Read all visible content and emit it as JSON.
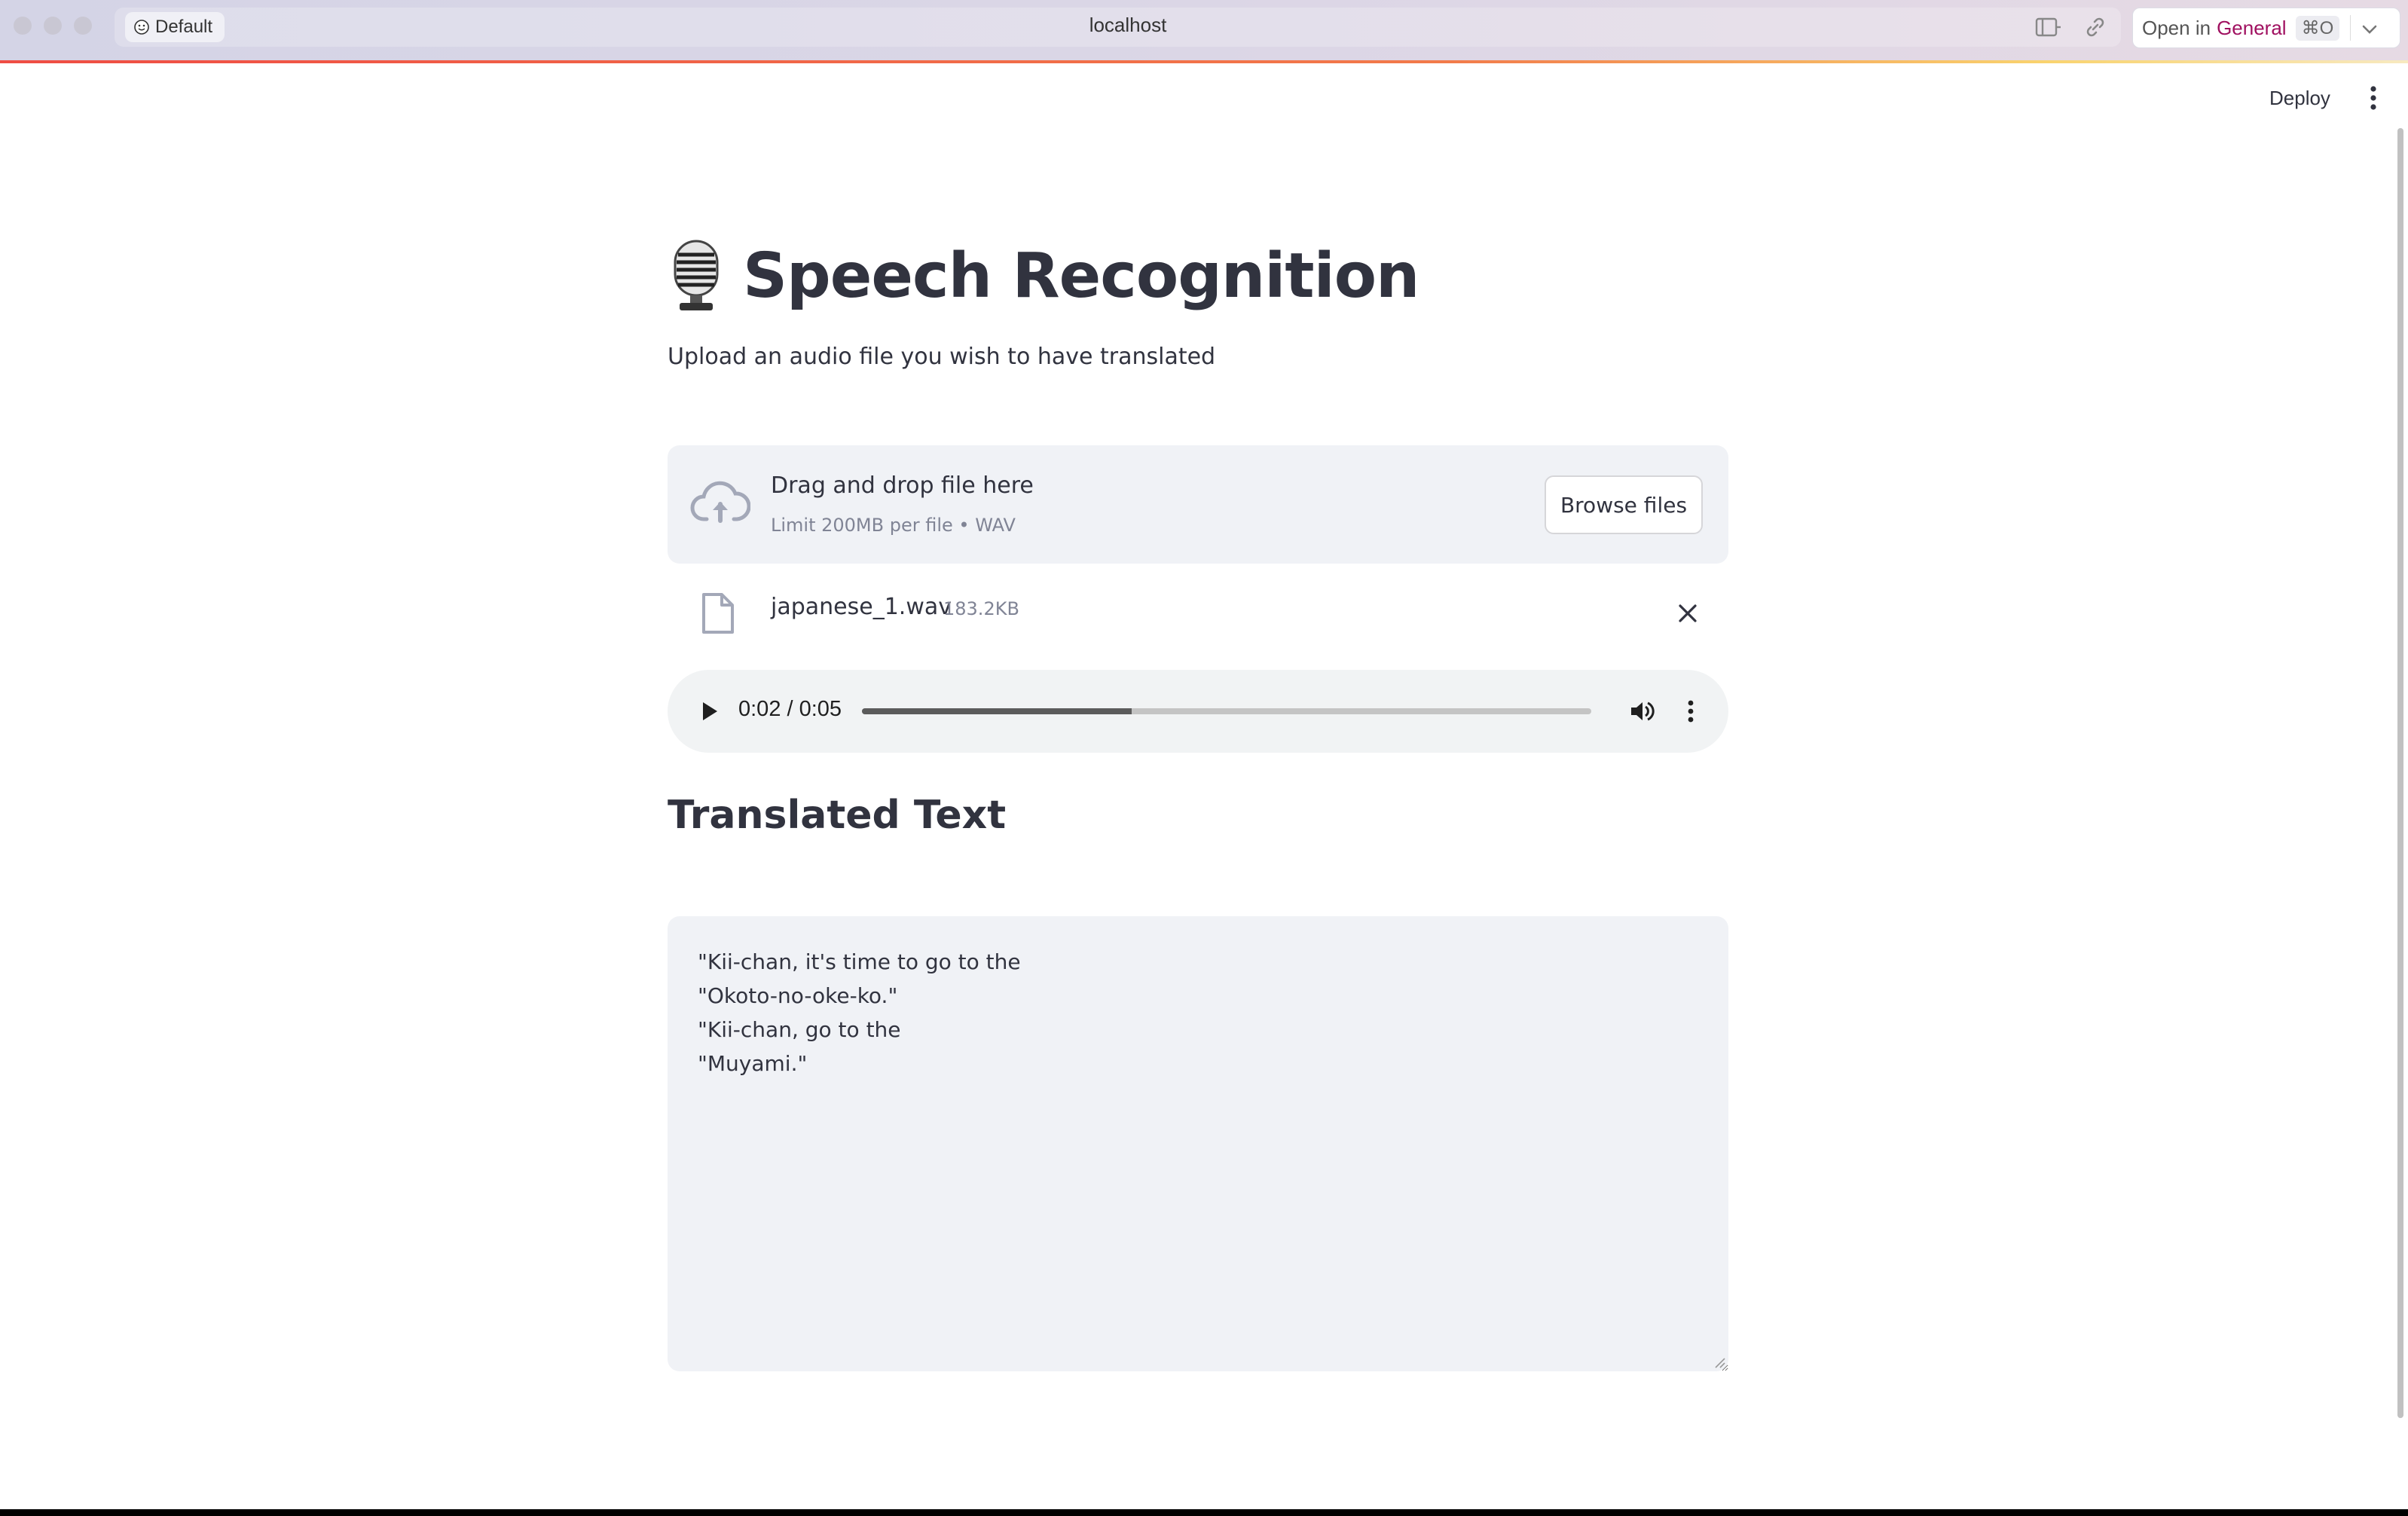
{
  "browser": {
    "profile_label": "Default",
    "url": "localhost",
    "open_in_label": "Open in",
    "open_in_target": "General",
    "open_in_shortcut": "⌘O"
  },
  "app_toolbar": {
    "deploy_label": "Deploy"
  },
  "page": {
    "title_icon": "🎙️",
    "title": "Speech Recognition",
    "subtitle": "Upload an audio file you wish to have translated"
  },
  "uploader": {
    "drag_text": "Drag and drop file here",
    "limit_text": "Limit 200MB per file • WAV",
    "browse_label": "Browse files",
    "file": {
      "name": "japanese_1.wav",
      "size": "183.2KB"
    }
  },
  "audio_player": {
    "time_display": "0:02 / 0:05",
    "progress_fraction": 0.37
  },
  "translation": {
    "heading": "Translated Text",
    "text": "\"Kii-chan, it's time to go to the\n\"Okoto-no-oke-ko.\"\n\"Kii-chan, go to the\n\"Muyami.\""
  },
  "colors": {
    "accent_bar": "#ef4d44",
    "text_primary": "#31333f",
    "surface": "#f0f2f6",
    "brand_open_in": "#a01060"
  }
}
